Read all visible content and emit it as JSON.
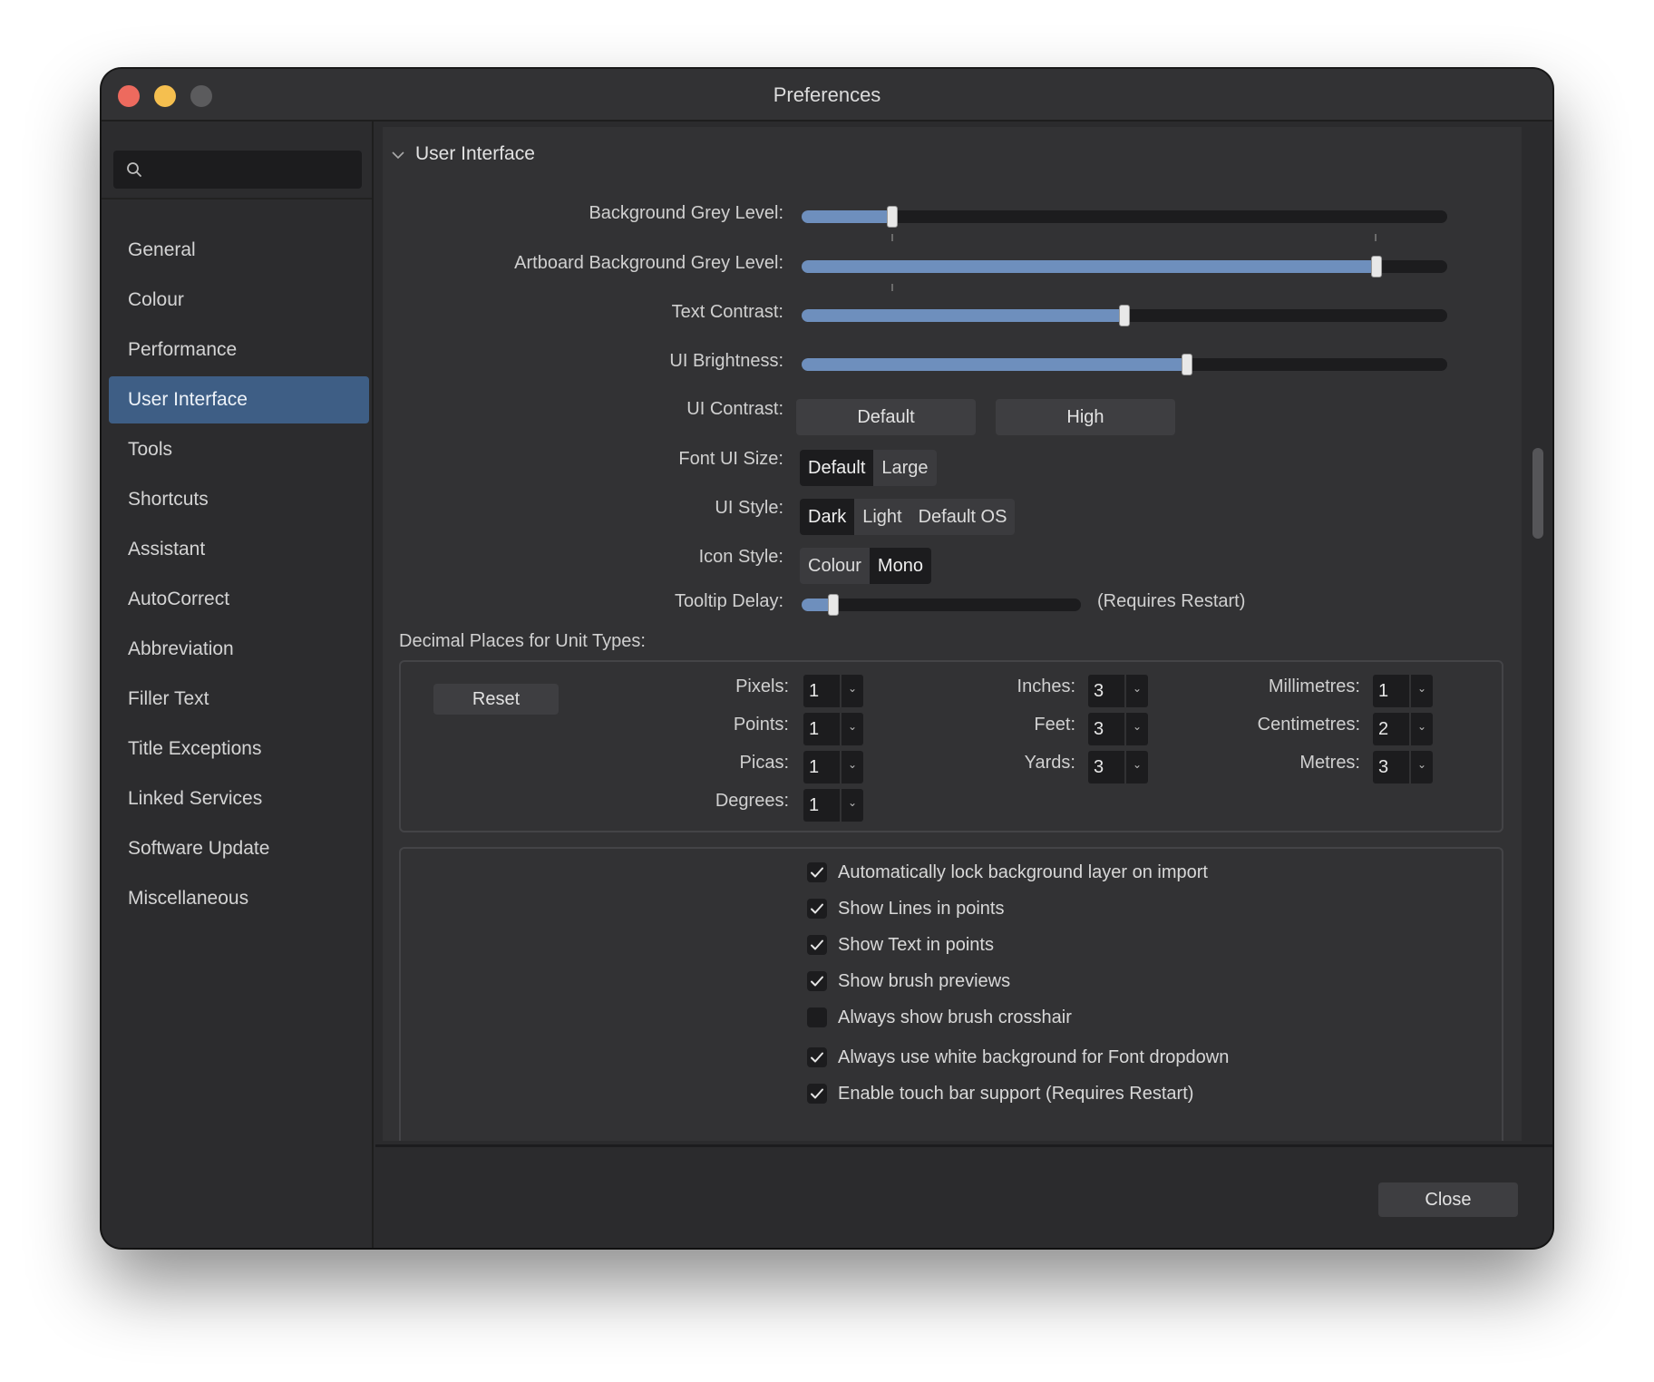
{
  "window": {
    "title": "Preferences"
  },
  "search": {
    "placeholder": ""
  },
  "sidebar": {
    "items": [
      {
        "label": "General"
      },
      {
        "label": "Colour"
      },
      {
        "label": "Performance"
      },
      {
        "label": "User Interface",
        "active": true
      },
      {
        "label": "Tools"
      },
      {
        "label": "Shortcuts"
      },
      {
        "label": "Assistant"
      },
      {
        "label": "AutoCorrect"
      },
      {
        "label": "Abbreviation"
      },
      {
        "label": "Filler Text"
      },
      {
        "label": "Title Exceptions"
      },
      {
        "label": "Linked Services"
      },
      {
        "label": "Software Update"
      },
      {
        "label": "Miscellaneous"
      }
    ]
  },
  "section": {
    "title": "User Interface"
  },
  "sliders": {
    "background_grey": {
      "label": "Background Grey Level:",
      "value": 0.14
    },
    "artboard_grey": {
      "label": "Artboard Background Grey Level:",
      "value": 0.89
    },
    "text_contrast": {
      "label": "Text Contrast:",
      "value": 0.5
    },
    "ui_brightness": {
      "label": "UI Brightness:",
      "value": 0.597
    },
    "tooltip_delay": {
      "label": "Tooltip Delay:",
      "value": 0.115,
      "note": "(Requires Restart)"
    }
  },
  "ui_contrast": {
    "label": "UI Contrast:",
    "options": [
      "Default",
      "High"
    ]
  },
  "font_ui_size": {
    "label": "Font UI Size:",
    "options": [
      "Default",
      "Large"
    ],
    "selected": "Default"
  },
  "ui_style": {
    "label": "UI Style:",
    "options": [
      "Dark",
      "Light",
      "Default OS"
    ],
    "selected": "Dark"
  },
  "icon_style": {
    "label": "Icon Style:",
    "options": [
      "Colour",
      "Mono"
    ],
    "selected": "Mono"
  },
  "decimal_places": {
    "heading": "Decimal Places for Unit Types:",
    "reset_label": "Reset",
    "units": [
      {
        "label": "Pixels:",
        "value": "1"
      },
      {
        "label": "Points:",
        "value": "1"
      },
      {
        "label": "Picas:",
        "value": "1"
      },
      {
        "label": "Degrees:",
        "value": "1"
      },
      {
        "label": "Inches:",
        "value": "3"
      },
      {
        "label": "Feet:",
        "value": "3"
      },
      {
        "label": "Yards:",
        "value": "3"
      },
      {
        "label": "Millimetres:",
        "value": "1"
      },
      {
        "label": "Centimetres:",
        "value": "2"
      },
      {
        "label": "Metres:",
        "value": "3"
      }
    ]
  },
  "checkboxes": [
    {
      "label": "Automatically lock background layer on import",
      "checked": true
    },
    {
      "label": "Show Lines in points",
      "checked": true
    },
    {
      "label": "Show Text in points",
      "checked": true
    },
    {
      "label": "Show brush previews",
      "checked": true
    },
    {
      "label": "Always show brush crosshair",
      "checked": false
    },
    {
      "label": "Always use white background for Font dropdown",
      "checked": true
    },
    {
      "label": "Enable touch bar support (Requires Restart)",
      "checked": true
    }
  ],
  "footer": {
    "close_label": "Close"
  },
  "colors": {
    "accent": "#3e5e85",
    "slider_fill": "#6e8fbd",
    "background": "#2b2b2d"
  }
}
